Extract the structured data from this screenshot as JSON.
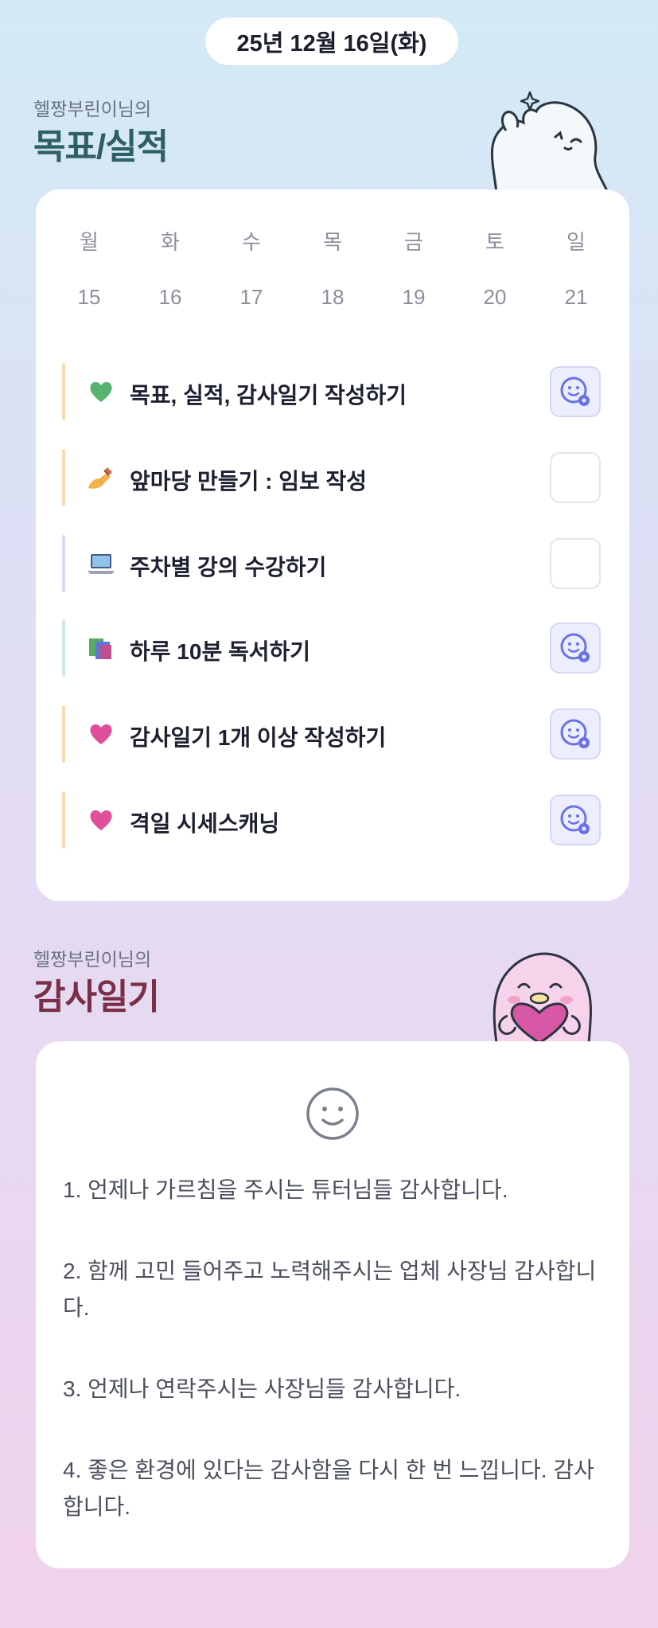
{
  "date": "25년 12월 16일(화)",
  "goals_section": {
    "owner": "헬짱부린이님의",
    "title": "목표/실적"
  },
  "calendar": {
    "weekdays": [
      "월",
      "화",
      "수",
      "목",
      "금",
      "토",
      "일"
    ],
    "days": [
      "15",
      "16",
      "17",
      "18",
      "19",
      "20",
      "21"
    ]
  },
  "goals": [
    {
      "emoji": "green-heart-icon",
      "label": "목표, 실적, 감사일기 작성하기",
      "checked": true,
      "bar_color": "#f7dcb3"
    },
    {
      "emoji": "writing-hand-icon",
      "label": "앞마당 만들기 : 임보 작성",
      "checked": false,
      "bar_color": "#f7dcb3"
    },
    {
      "emoji": "laptop-icon",
      "label": "주차별 강의 수강하기",
      "checked": false,
      "bar_color": "#d4dcf4"
    },
    {
      "emoji": "books-icon",
      "label": "하루 10분 독서하기",
      "checked": true,
      "bar_color": "#cfeadb"
    },
    {
      "emoji": "pink-heart-icon",
      "label": "감사일기 1개 이상 작성하기",
      "checked": true,
      "bar_color": "#f7dcb3"
    },
    {
      "emoji": "pink-heart-icon",
      "label": "격일 시세스캐닝",
      "checked": true,
      "bar_color": "#f7dcb3"
    }
  ],
  "thanks_section": {
    "owner": "헬짱부린이님의",
    "title": "감사일기",
    "entries": [
      "1. 언제나 가르침을 주시는 튜터님들 감사합니다.",
      "2. 함께 고민 들어주고 노력해주시는 업체 사장님 감사합니다.",
      "3. 언제나 연락주시는 사장님들 감사합니다.",
      "4. 좋은 환경에 있다는 감사함을 다시 한 번 느낍니다. 감사합니다."
    ]
  },
  "colors": {
    "accent": "#6a72e6",
    "check_bg": "#eceefe",
    "goal_title": "#2f5f66",
    "thanks_title": "#7a2f46"
  }
}
